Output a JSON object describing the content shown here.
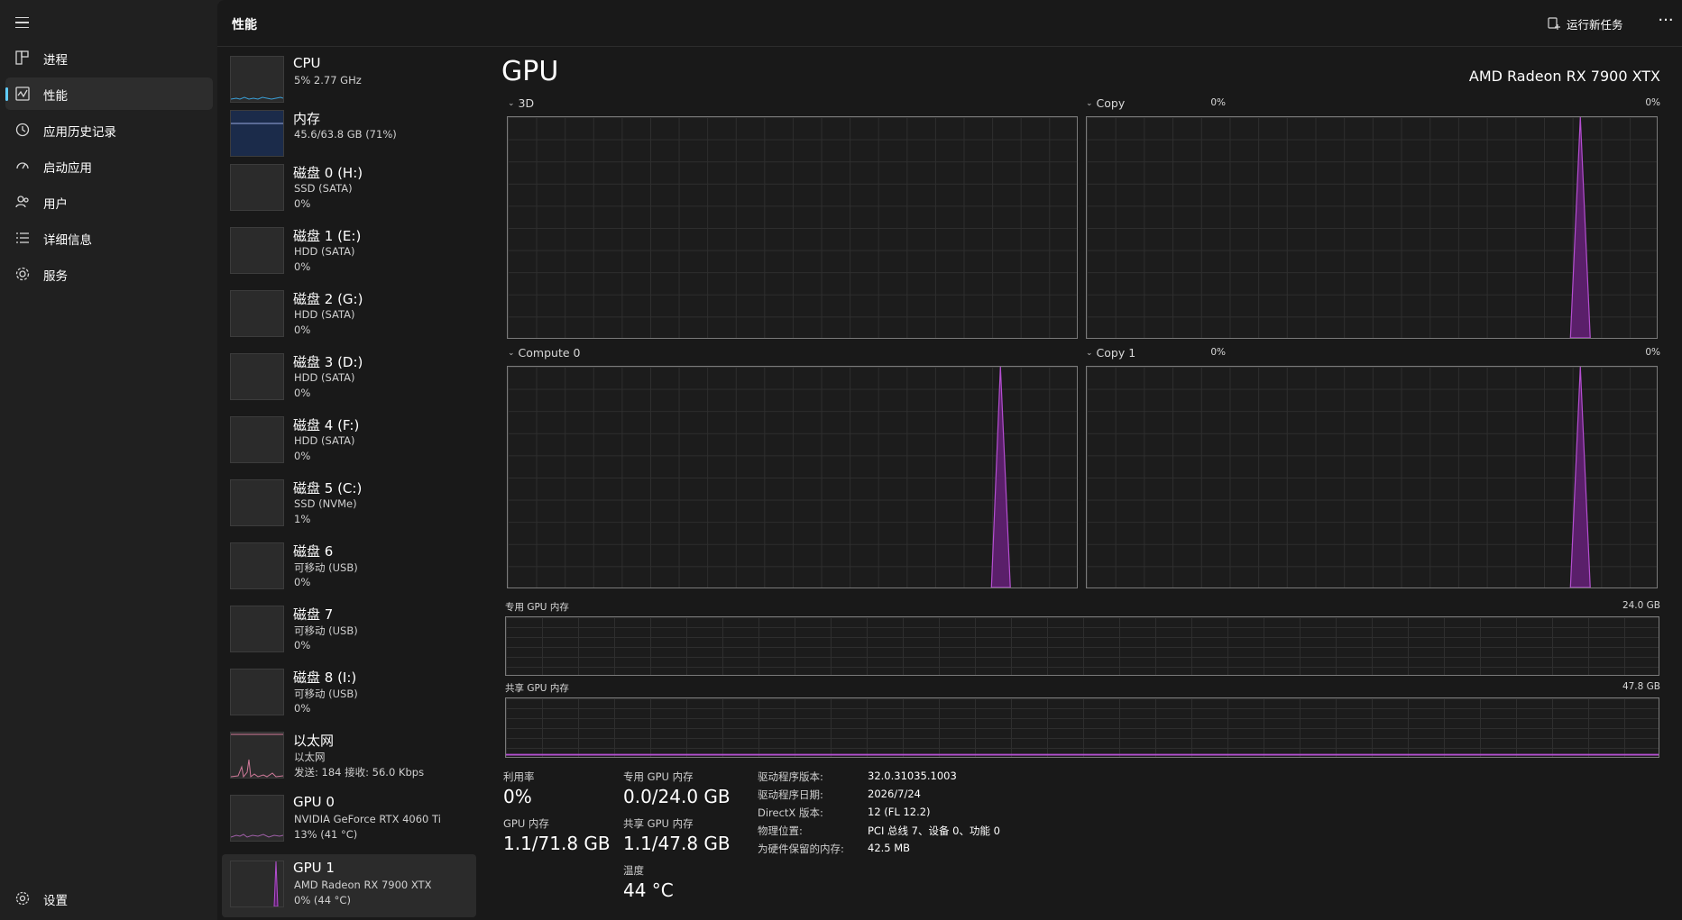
{
  "nav": {
    "items": [
      {
        "label": "进程",
        "icon": "processes-icon"
      },
      {
        "label": "性能",
        "icon": "performance-icon",
        "active": true
      },
      {
        "label": "应用历史记录",
        "icon": "app-history-icon"
      },
      {
        "label": "启动应用",
        "icon": "startup-apps-icon"
      },
      {
        "label": "用户",
        "icon": "users-icon"
      },
      {
        "label": "详细信息",
        "icon": "details-icon"
      },
      {
        "label": "服务",
        "icon": "services-icon"
      }
    ],
    "settings_label": "设置"
  },
  "header": {
    "title": "性能",
    "run_task_label": "运行新任务",
    "more_label": "···"
  },
  "devices": [
    {
      "name": "CPU",
      "sub": "5% 2.77 GHz",
      "value": ""
    },
    {
      "name": "内存",
      "sub": "45.6/63.8 GB (71%)",
      "value": ""
    },
    {
      "name": "磁盘 0 (H:)",
      "sub": "SSD (SATA)",
      "value": "0%"
    },
    {
      "name": "磁盘 1 (E:)",
      "sub": "HDD (SATA)",
      "value": "0%"
    },
    {
      "name": "磁盘 2 (G:)",
      "sub": "HDD (SATA)",
      "value": "0%"
    },
    {
      "name": "磁盘 3 (D:)",
      "sub": "HDD (SATA)",
      "value": "0%"
    },
    {
      "name": "磁盘 4 (F:)",
      "sub": "HDD (SATA)",
      "value": "0%"
    },
    {
      "name": "磁盘 5 (C:)",
      "sub": "SSD (NVMe)",
      "value": "1%"
    },
    {
      "name": "磁盘 6",
      "sub": "可移动 (USB)",
      "value": "0%"
    },
    {
      "name": "磁盘 7",
      "sub": "可移动 (USB)",
      "value": "0%"
    },
    {
      "name": "磁盘 8 (I:)",
      "sub": "可移动 (USB)",
      "value": "0%"
    },
    {
      "name": "以太网",
      "sub": "以太网",
      "value": "发送: 184 接收: 56.0 Kbps"
    },
    {
      "name": "GPU 0",
      "sub": "NVIDIA GeForce RTX 4060 Ti",
      "value": "13% (41 °C)"
    },
    {
      "name": "GPU 1",
      "sub": "AMD Radeon RX 7900 XTX",
      "value": "0% (44 °C)",
      "selected": true
    }
  ],
  "gpu": {
    "heading": "GPU",
    "model": "AMD Radeon RX 7900 XTX",
    "engines": [
      {
        "label": "3D",
        "percent": "0%"
      },
      {
        "label": "Copy",
        "percent": "0%"
      },
      {
        "label": "Compute 0",
        "percent": "0%"
      },
      {
        "label": "Copy 1",
        "percent": "0%"
      }
    ],
    "dedicated_mem": {
      "label": "专用 GPU 内存",
      "max": "24.0 GB"
    },
    "shared_mem": {
      "label": "共享 GPU 内存",
      "max": "47.8 GB"
    },
    "stats": {
      "utilization": {
        "label": "利用率",
        "value": "0%"
      },
      "dedicated": {
        "label": "专用 GPU 内存",
        "value": "0.0/24.0 GB"
      },
      "gpu_memory": {
        "label": "GPU 内存",
        "value": "1.1/71.8 GB"
      },
      "shared": {
        "label": "共享 GPU 内存",
        "value": "1.1/47.8 GB"
      },
      "temperature": {
        "label": "温度",
        "value": "44 °C"
      }
    },
    "info": [
      {
        "key": "驱动程序版本:",
        "value": "32.0.31035.1003"
      },
      {
        "key": "驱动程序日期:",
        "value": "2026/7/24"
      },
      {
        "key": "DirectX 版本:",
        "value": "12 (FL 12.2)"
      },
      {
        "key": "物理位置:",
        "value": "PCI 总线 7、设备 0、功能 0"
      },
      {
        "key": "为硬件保留的内存:",
        "value": "42.5 MB"
      }
    ]
  },
  "colors": {
    "accent": "#60cdff",
    "gpu_line": "#b44fd0",
    "gpu_fill": "#5a1f6a",
    "cpu_line": "#3aa0d8",
    "memory_line": "#9aa8e0",
    "network_line": "#d07a9a",
    "gpu0_line": "#a05fa8"
  }
}
